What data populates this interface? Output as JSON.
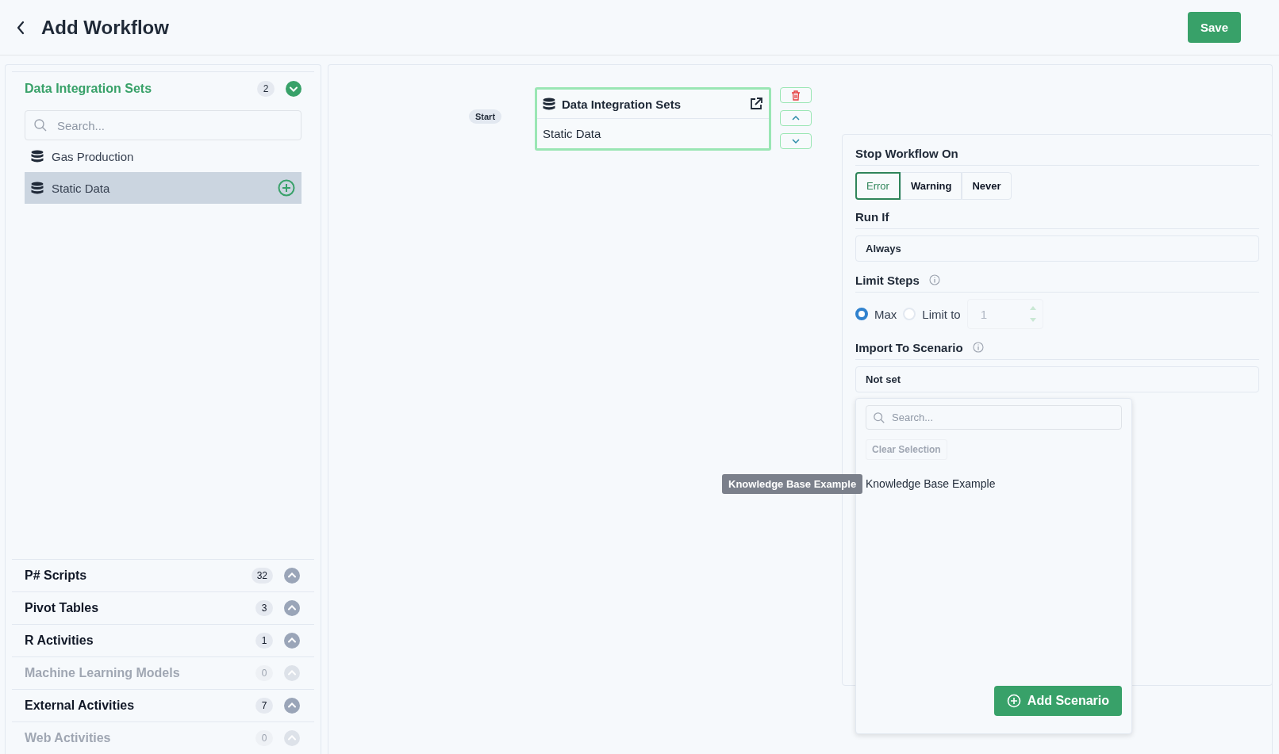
{
  "header": {
    "title": "Add Workflow",
    "save_button": "Save"
  },
  "sidebar": {
    "sections": [
      {
        "title": "Data Integration Sets",
        "count": "2",
        "expanded": true,
        "disabled": false,
        "search_placeholder": "Search...",
        "items": [
          {
            "label": "Gas Production",
            "selected": false
          },
          {
            "label": "Static Data",
            "selected": true
          }
        ]
      },
      {
        "title": "P# Scripts",
        "count": "32",
        "expanded": false,
        "disabled": false
      },
      {
        "title": "Pivot Tables",
        "count": "3",
        "expanded": false,
        "disabled": false
      },
      {
        "title": "R Activities",
        "count": "1",
        "expanded": false,
        "disabled": false
      },
      {
        "title": "Machine Learning Models",
        "count": "0",
        "expanded": false,
        "disabled": true
      },
      {
        "title": "External Activities",
        "count": "7",
        "expanded": false,
        "disabled": false
      },
      {
        "title": "Web Activities",
        "count": "0",
        "expanded": false,
        "disabled": true
      }
    ]
  },
  "canvas": {
    "start_label": "Start",
    "node": {
      "title": "Data Integration Sets",
      "subtitle": "Static Data"
    }
  },
  "settings": {
    "stop_workflow_on": {
      "label": "Stop Workflow On",
      "options": [
        {
          "label": "Error",
          "selected": true
        },
        {
          "label": "Warning",
          "selected": false
        },
        {
          "label": "Never",
          "selected": false
        }
      ]
    },
    "run_if": {
      "label": "Run If",
      "value": "Always"
    },
    "limit_steps": {
      "label": "Limit Steps",
      "options": [
        {
          "label": "Max",
          "selected": true
        },
        {
          "label": "Limit to",
          "selected": false
        }
      ],
      "value": "1"
    },
    "import_to_scenario": {
      "label": "Import To Scenario",
      "value": "Not set"
    },
    "dropdown": {
      "search_placeholder": "Search...",
      "clear_button": "Clear Selection",
      "options": [
        {
          "label": "Knowledge Base Example"
        }
      ],
      "tooltip": "Knowledge Base Example",
      "add_button": "Add Scenario"
    }
  }
}
